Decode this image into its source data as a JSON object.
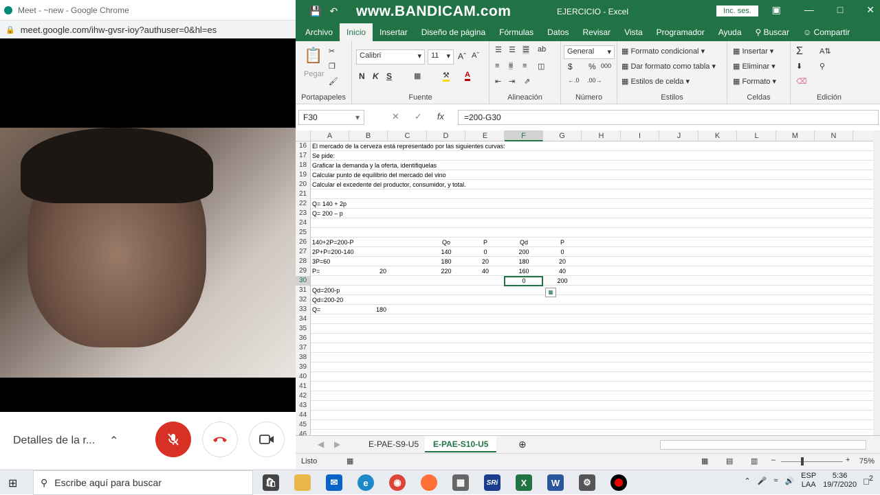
{
  "chrome": {
    "title": "Meet - ~new - Google Chrome",
    "url": "meet.google.com/ihw-gvsr-ioy?authuser=0&hl=es"
  },
  "meet": {
    "details_label": "Detalles de la r...",
    "mic_icon": "mic-off-icon",
    "hangup_icon": "phone-hangup-icon",
    "camera_icon": "camera-icon",
    "mic_color": "#d93025"
  },
  "excel": {
    "watermark": "www.BANDICAM.com",
    "doc_title": "EJERCICIO  -  Excel",
    "signin_label": "Inc. ses.",
    "tabs": [
      "Archivo",
      "Inicio",
      "Insertar",
      "Diseño de página",
      "Fórmulas",
      "Datos",
      "Revisar",
      "Vista",
      "Programador",
      "Ayuda",
      "Buscar",
      "Compartir"
    ],
    "active_tab": "Inicio",
    "ribbon": {
      "clipboard": {
        "paste": "Pegar",
        "label": "Portapapeles"
      },
      "font": {
        "name": "Calibri",
        "size": "11",
        "bold": "N",
        "italic": "K",
        "underline": "S",
        "label": "Fuente"
      },
      "alignment": {
        "label": "Alineación"
      },
      "number": {
        "format": "General",
        "percent": "%",
        "thousands": "000",
        "currency": "$",
        "label": "Número"
      },
      "styles": {
        "conditional": "Formato condicional",
        "table": "Dar formato como tabla",
        "cell_styles": "Estilos de celda",
        "label": "Estilos"
      },
      "cells": {
        "insert": "Insertar",
        "delete": "Eliminar",
        "format": "Formato",
        "label": "Celdas"
      },
      "editing": {
        "label": "Edición"
      }
    },
    "name_box": "F30",
    "formula": "=200-G30",
    "columns": [
      "A",
      "B",
      "C",
      "D",
      "E",
      "F",
      "G",
      "H",
      "I",
      "J",
      "K",
      "L",
      "M",
      "N"
    ],
    "selected_column": "F",
    "selected_row": "30",
    "rows": [
      {
        "n": "16",
        "cells": {
          "A": "El mercado de la cerveza está representado por las siguientes curvas:"
        }
      },
      {
        "n": "17",
        "cells": {
          "A": "Se pide:"
        }
      },
      {
        "n": "18",
        "cells": {
          "A": "Graficar la demanda y la oferta, identifiquelas"
        }
      },
      {
        "n": "19",
        "cells": {
          "A": "Calcular punto de equilibrio del mercado del vino"
        }
      },
      {
        "n": "20",
        "cells": {
          "A": "Calcular el excedente del productor, consumidor, y total."
        }
      },
      {
        "n": "21",
        "cells": {}
      },
      {
        "n": "22",
        "cells": {
          "A": "Q= 140 + 2p"
        }
      },
      {
        "n": "23",
        "cells": {
          "A": "Q= 200 – p"
        }
      },
      {
        "n": "24",
        "cells": {}
      },
      {
        "n": "25",
        "cells": {}
      },
      {
        "n": "26",
        "cells": {
          "A": "140+2P=200-P",
          "D": "Qo",
          "E": "P",
          "F": "Qd",
          "G": "P"
        }
      },
      {
        "n": "27",
        "cells": {
          "A": "2P+P=200-140",
          "D": "140",
          "E": "0",
          "F": "200",
          "G": "0"
        }
      },
      {
        "n": "28",
        "cells": {
          "A": "3P=60",
          "D": "180",
          "E": "20",
          "F": "180",
          "G": "20"
        }
      },
      {
        "n": "29",
        "cells": {
          "A": "P=",
          "B": "20",
          "D": "220",
          "E": "40",
          "F": "160",
          "G": "40"
        }
      },
      {
        "n": "30",
        "cells": {
          "F": "0",
          "G": "200"
        }
      },
      {
        "n": "31",
        "cells": {
          "A": "Qd=200-p"
        }
      },
      {
        "n": "32",
        "cells": {
          "A": "Qd=200-20"
        }
      },
      {
        "n": "33",
        "cells": {
          "A": "Q=",
          "B": "180"
        }
      },
      {
        "n": "34",
        "cells": {}
      },
      {
        "n": "35",
        "cells": {}
      },
      {
        "n": "36",
        "cells": {}
      },
      {
        "n": "37",
        "cells": {}
      },
      {
        "n": "38",
        "cells": {}
      },
      {
        "n": "39",
        "cells": {}
      },
      {
        "n": "40",
        "cells": {}
      },
      {
        "n": "41",
        "cells": {}
      },
      {
        "n": "42",
        "cells": {}
      },
      {
        "n": "43",
        "cells": {}
      },
      {
        "n": "44",
        "cells": {}
      },
      {
        "n": "45",
        "cells": {}
      },
      {
        "n": "46",
        "cells": {}
      }
    ],
    "sheets": [
      "E-PAE-S9-U5",
      "E-PAE-S10-U5"
    ],
    "active_sheet": "E-PAE-S10-U5",
    "status": "Listo",
    "zoom": "75%",
    "accent": "#217346"
  },
  "taskbar": {
    "search_placeholder": "Escribe aquí para buscar",
    "lang": "ESP",
    "lang2": "LAA",
    "time": "5:36",
    "date": "19/7/2020",
    "notification_count": "2"
  }
}
